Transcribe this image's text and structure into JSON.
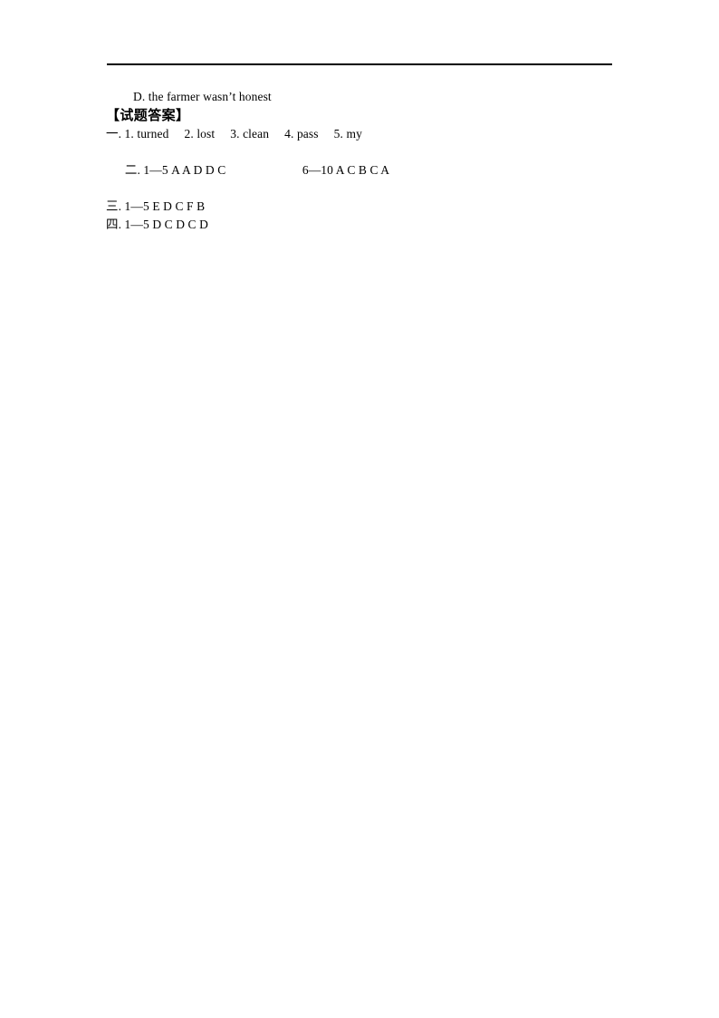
{
  "document": {
    "page_background": "#ffffff",
    "text_color": "#000000",
    "rule_color": "#000000"
  },
  "option": {
    "letter": "D.",
    "text": "the farmer wasn’t honest",
    "full": "D. the farmer wasn’t honest"
  },
  "heading": {
    "text": "【试题答案】"
  },
  "answers": [
    {
      "marker": "一",
      "marker_punct": ".",
      "left": "一. 1. turned  2. lost  3. clean  4. pass  5. my",
      "right": "",
      "items": [
        {
          "number": "1.",
          "value": "turned"
        },
        {
          "number": "2.",
          "value": "lost"
        },
        {
          "number": "3.",
          "value": "clean"
        },
        {
          "number": "4.",
          "value": "pass"
        },
        {
          "number": "5.",
          "value": "my"
        }
      ]
    },
    {
      "marker": "二",
      "marker_punct": ".",
      "left": "二. 1—5 A A D D C",
      "right": "6—10 A C B C A",
      "items": [
        {
          "range": "1—5",
          "value": "A A D D C"
        },
        {
          "range": "6—10",
          "value": "A C B C A"
        }
      ]
    },
    {
      "marker": "三",
      "marker_punct": ".",
      "left": "三. 1—5 E D C F B",
      "right": "",
      "items": [
        {
          "range": "1—5",
          "value": "E D C F B"
        }
      ]
    },
    {
      "marker": "四",
      "marker_punct": ".",
      "left": "四. 1—5 D C D C D",
      "right": "",
      "items": [
        {
          "range": "1—5",
          "value": "D C D C D"
        }
      ]
    }
  ]
}
